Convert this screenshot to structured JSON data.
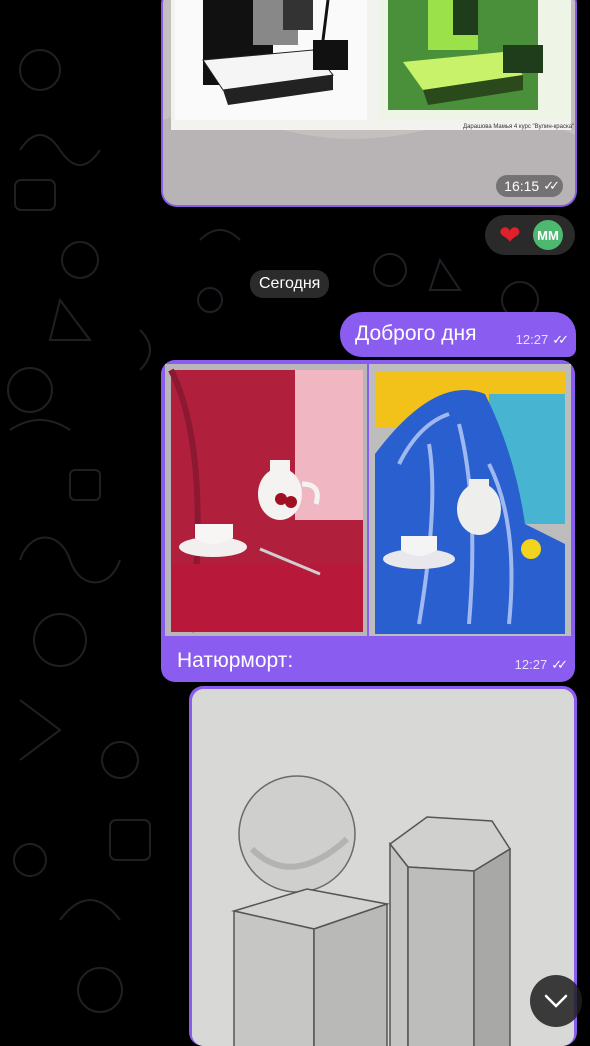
{
  "messages": {
    "photo1": {
      "time": "16:15",
      "caption": "Дарашова Мамья 4 курс \"Вулин-краска\""
    },
    "reactions": {
      "heart": "❤",
      "avatar_initials": "ММ"
    },
    "date_separator": "Сегодня",
    "text_message": {
      "text": "Доброго дня",
      "time": "12:27"
    },
    "album": {
      "caption": "Натюрморт:",
      "time": "12:27"
    }
  },
  "colors": {
    "accent": "#8b5cf0",
    "reaction_bg": "#2a2a2a",
    "heart": "#e0202a",
    "avatar": "#4fb870"
  },
  "icons": {
    "read_receipt": "double-check-icon",
    "scroll_down": "chevron-down-icon"
  }
}
